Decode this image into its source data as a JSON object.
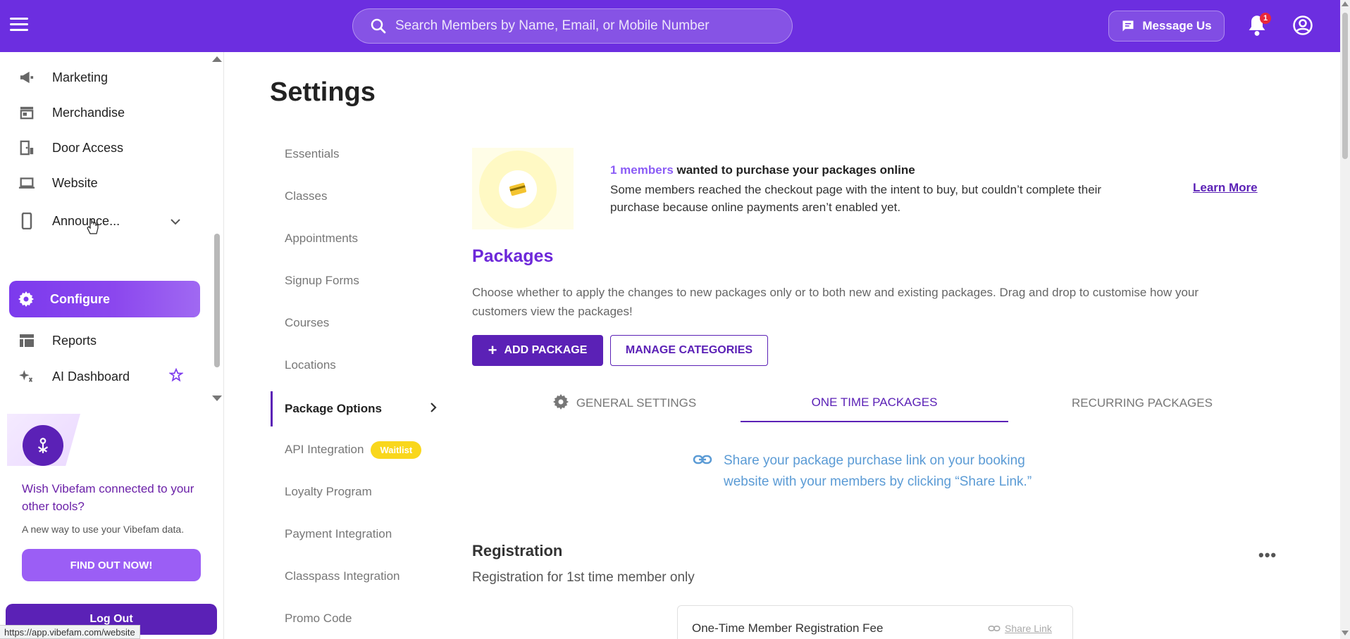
{
  "topbar": {
    "search_placeholder": "Search Members by Name, Email, or Mobile Number",
    "message_label": "Message Us",
    "notification_count": "1",
    "brand_color": "#6c2ee0"
  },
  "sidebar": {
    "items": [
      {
        "label": "Marketing",
        "icon": "megaphone-icon"
      },
      {
        "label": "Merchandise",
        "icon": "store-icon"
      },
      {
        "label": "Door Access",
        "icon": "door-icon"
      },
      {
        "label": "Website",
        "icon": "laptop-icon"
      },
      {
        "label": "Announce...",
        "icon": "phone-icon"
      },
      {
        "label": "Configure",
        "icon": "gear-icon"
      },
      {
        "label": "Reports",
        "icon": "table-icon"
      },
      {
        "label": "AI Dashboard",
        "icon": "sparkle-icon"
      }
    ],
    "promo": {
      "title": "Wish Vibefam connected to your other tools?",
      "subtitle": "A new way to use your Vibefam data.",
      "button": "FIND OUT NOW!"
    },
    "logout": "Log Out",
    "status_url": "https://app.vibefam.com/website"
  },
  "main": {
    "title": "Settings",
    "subnav": [
      {
        "label": "Essentials"
      },
      {
        "label": "Classes"
      },
      {
        "label": "Appointments"
      },
      {
        "label": "Signup Forms"
      },
      {
        "label": "Courses"
      },
      {
        "label": "Locations"
      },
      {
        "label": "Package Options"
      },
      {
        "label": "API Integration",
        "badge": "Waitlist"
      },
      {
        "label": "Loyalty Program"
      },
      {
        "label": "Payment Integration"
      },
      {
        "label": "Classpass Integration"
      },
      {
        "label": "Promo Code"
      }
    ],
    "banner": {
      "count": "1 members",
      "headline": " wanted to purchase your packages online",
      "body": "Some members reached the checkout page with the intent to buy, but couldn’t complete their purchase because online payments aren’t enabled yet.",
      "learn_more": "Learn More"
    },
    "packages": {
      "title": "Packages",
      "description": "Choose whether to apply the changes to new packages only or to both new and existing packages. Drag and drop to customise how your customers view the packages!",
      "add_button": "ADD PACKAGE",
      "manage_button": "MANAGE CATEGORIES",
      "tabs": [
        {
          "label": "GENERAL SETTINGS"
        },
        {
          "label": "ONE TIME PACKAGES"
        },
        {
          "label": "RECURRING PACKAGES"
        }
      ],
      "share_note": "Share your package purchase link on your booking website with your members by clicking “Share Link.”"
    },
    "registration": {
      "title": "Registration",
      "subtitle": "Registration for 1st time member only",
      "card_name": "One-Time Member Registration Fee",
      "share_link": "Share Link"
    }
  }
}
